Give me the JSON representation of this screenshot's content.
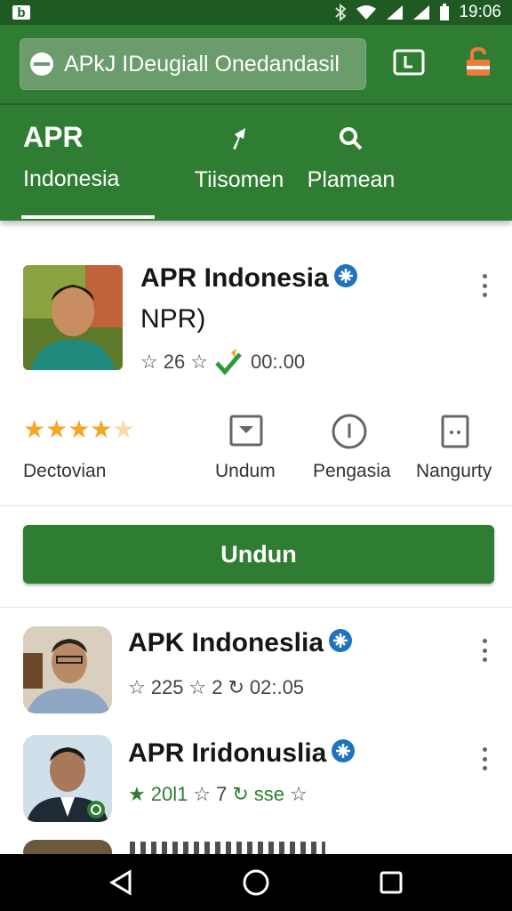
{
  "status_bar": {
    "left_badge": "b",
    "time": "19:06"
  },
  "search": {
    "text": "APkJ IDeugiall Onedandasil"
  },
  "tabs": [
    {
      "title": "APR",
      "label": "Indonesia"
    },
    {
      "label": "Tiisomen",
      "icon": "pin-icon"
    },
    {
      "label": "Plamean",
      "icon": "search-icon"
    }
  ],
  "featured": {
    "name": "APR Indonesia",
    "subtitle": "NPR)",
    "rating": "26",
    "meta_time": "00:.00",
    "stats": {
      "rating_label": "Dectovian",
      "rating_stars": 4.5,
      "items": [
        {
          "label": "Undum",
          "icon": "download-icon"
        },
        {
          "label": "Pengasia",
          "icon": "info-icon"
        },
        {
          "label": "Nangurty",
          "icon": "tablet-icon"
        }
      ]
    },
    "install_label": "Undun"
  },
  "list": [
    {
      "name": "APK Indoneslia",
      "rating": "225",
      "second": "2",
      "time": "02:.05"
    },
    {
      "name": "APR Iridonuslia",
      "rating": "20l1",
      "second": "7",
      "suffix": "sse"
    }
  ],
  "colors": {
    "primary": "#2e7d32",
    "statusbar": "#1e5a22",
    "accent_star": "#f5a623",
    "verified": "#1e73be"
  }
}
